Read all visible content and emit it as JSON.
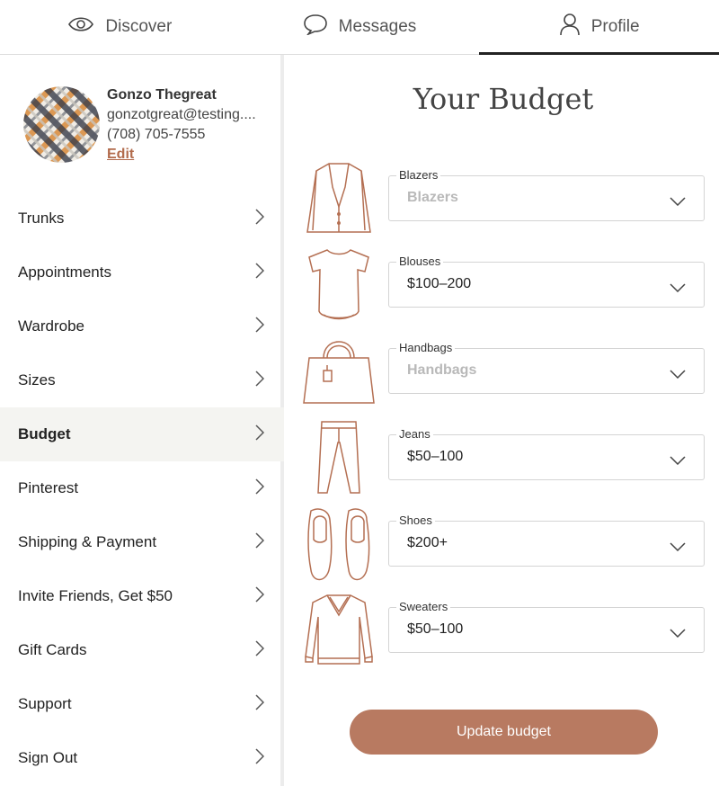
{
  "nav": {
    "tabs": [
      {
        "label": "Discover",
        "icon": "eye-icon"
      },
      {
        "label": "Messages",
        "icon": "chat-bubble-icon"
      },
      {
        "label": "Profile",
        "icon": "user-icon",
        "active": true
      }
    ]
  },
  "profile": {
    "name": "Gonzo Thegreat",
    "email": "gonzotgreat@testing....",
    "phone": "(708) 705-7555",
    "edit_label": "Edit"
  },
  "sidebar": {
    "items": [
      {
        "label": "Trunks"
      },
      {
        "label": "Appointments"
      },
      {
        "label": "Wardrobe"
      },
      {
        "label": "Sizes"
      },
      {
        "label": "Budget",
        "active": true
      },
      {
        "label": "Pinterest"
      },
      {
        "label": "Shipping & Payment"
      },
      {
        "label": "Invite Friends, Get $50"
      },
      {
        "label": "Gift Cards"
      },
      {
        "label": "Support"
      },
      {
        "label": "Sign Out"
      }
    ]
  },
  "budget": {
    "title": "Your Budget",
    "fields": [
      {
        "label": "Blazers",
        "value": "Blazers",
        "placeholder": true,
        "icon": "blazer-icon"
      },
      {
        "label": "Blouses",
        "value": "$100–200",
        "placeholder": false,
        "icon": "blouse-icon"
      },
      {
        "label": "Handbags",
        "value": "Handbags",
        "placeholder": true,
        "icon": "handbag-icon"
      },
      {
        "label": "Jeans",
        "value": "$50–100",
        "placeholder": false,
        "icon": "jeans-icon"
      },
      {
        "label": "Shoes",
        "value": "$200+",
        "placeholder": false,
        "icon": "shoes-icon"
      },
      {
        "label": "Sweaters",
        "value": "$50–100",
        "placeholder": false,
        "icon": "sweater-icon"
      }
    ],
    "update_label": "Update budget"
  },
  "colors": {
    "accent": "#b87a61",
    "link": "#b26b4c",
    "active_bg": "#f4f4f1"
  }
}
